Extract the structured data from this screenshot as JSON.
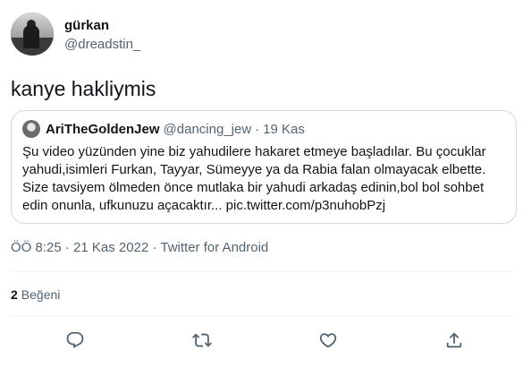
{
  "author": {
    "display_name": "gürkan",
    "handle": "@dreadstin_"
  },
  "tweet": {
    "text": "kanye hakliymis"
  },
  "quoted_tweet": {
    "display_name": "AriTheGoldenJew",
    "handle": "@dancing_jew",
    "separator": "·",
    "time": "19 Kas",
    "body": "Şu video yüzünden yine biz yahudilere hakaret etmeye başladılar. Bu çocuklar yahudi,isimleri Furkan, Tayyar, Sümeyye ya da Rabia falan olmayacak elbette. Size tavsiyem ölmeden önce mutlaka bir yahudi arkadaş edinin,bol bol sohbet edin onunla, ufkunuzu açacaktır... pic.twitter.com/p3nuhobPzj"
  },
  "meta": {
    "time": "ÖÖ 8:25",
    "sep1": "·",
    "date": "21 Kas 2022",
    "sep2": "·",
    "source": "Twitter for Android"
  },
  "stats": {
    "likes_count": "2",
    "likes_label": "Beğeni"
  },
  "actions": {
    "icons": [
      "reply-icon",
      "retweet-icon",
      "like-icon",
      "share-icon"
    ],
    "icon_color": "#536471"
  },
  "colors": {
    "text_primary": "#0f1419",
    "text_secondary": "#536471",
    "border": "#cfd9de"
  }
}
